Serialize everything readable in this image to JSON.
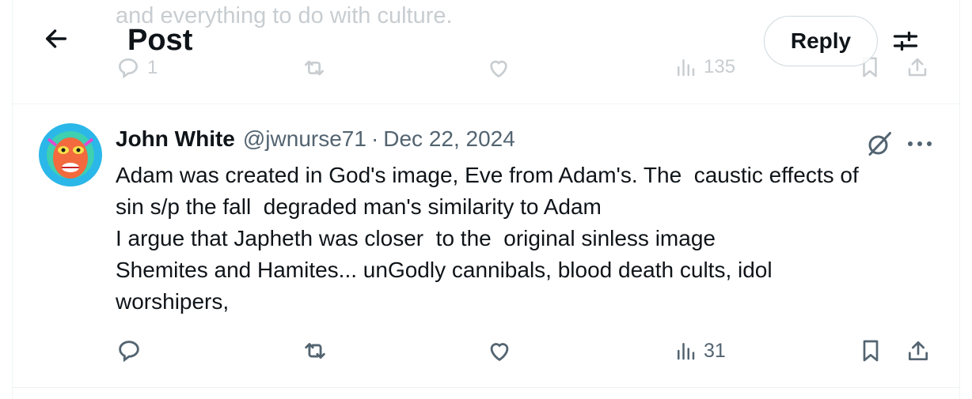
{
  "header": {
    "title": "Post",
    "reply_label": "Reply",
    "back_icon": "arrow-left-icon",
    "settings_icon": "sliders-icon"
  },
  "previous_post": {
    "text_fragment": "and everything to do with culture.",
    "replies": "1",
    "views": "135"
  },
  "post": {
    "author_name": "John White",
    "author_handle": "@jwnurse71",
    "separator": "·",
    "date": "Dec 22, 2024",
    "body_lines": [
      "Adam was created in God's image, Eve from Adam's. The  caustic effects of",
      "sin s/p the fall  degraded man's similarity to Adam",
      "I argue that Japheth was closer  to the  original sinless image",
      "Shemites and Hamites... unGodly cannibals, blood death cults, idol",
      "worshipers,"
    ],
    "views": "31"
  },
  "colors": {
    "text_primary": "#0f1419",
    "text_secondary": "#536471",
    "faded": "#c8cdd1",
    "border": "#eff3f4"
  }
}
